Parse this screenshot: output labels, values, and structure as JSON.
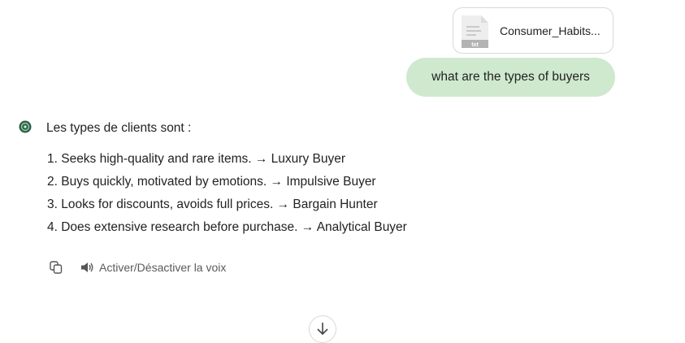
{
  "attachment": {
    "file_name": "Consumer_Habits...",
    "file_type": "txt",
    "icon": "text-file-icon"
  },
  "user_message": {
    "text": "what are the types of buyers"
  },
  "assistant_message": {
    "intro": "Les types de clients sont :",
    "items": [
      "1. Seeks high-quality and rare items. → Luxury Buyer",
      "2. Buys quickly, motivated by emotions. → Impulsive Buyer",
      "3. Looks for discounts, avoids full prices. → Bargain Hunter",
      "4. Does extensive research before purchase. → Analytical Buyer"
    ],
    "avatar_icon": "bot-avatar-icon"
  },
  "actions": {
    "copy_icon": "copy-icon",
    "voice_icon": "speaker-icon",
    "voice_label": "Activer/Désactiver la voix"
  },
  "scroll_button": {
    "icon": "arrow-down-icon"
  },
  "colors": {
    "user_bubble": "#cfe9cf",
    "avatar_bg": "#2f5d45",
    "muted_text": "#5a5a5a"
  }
}
